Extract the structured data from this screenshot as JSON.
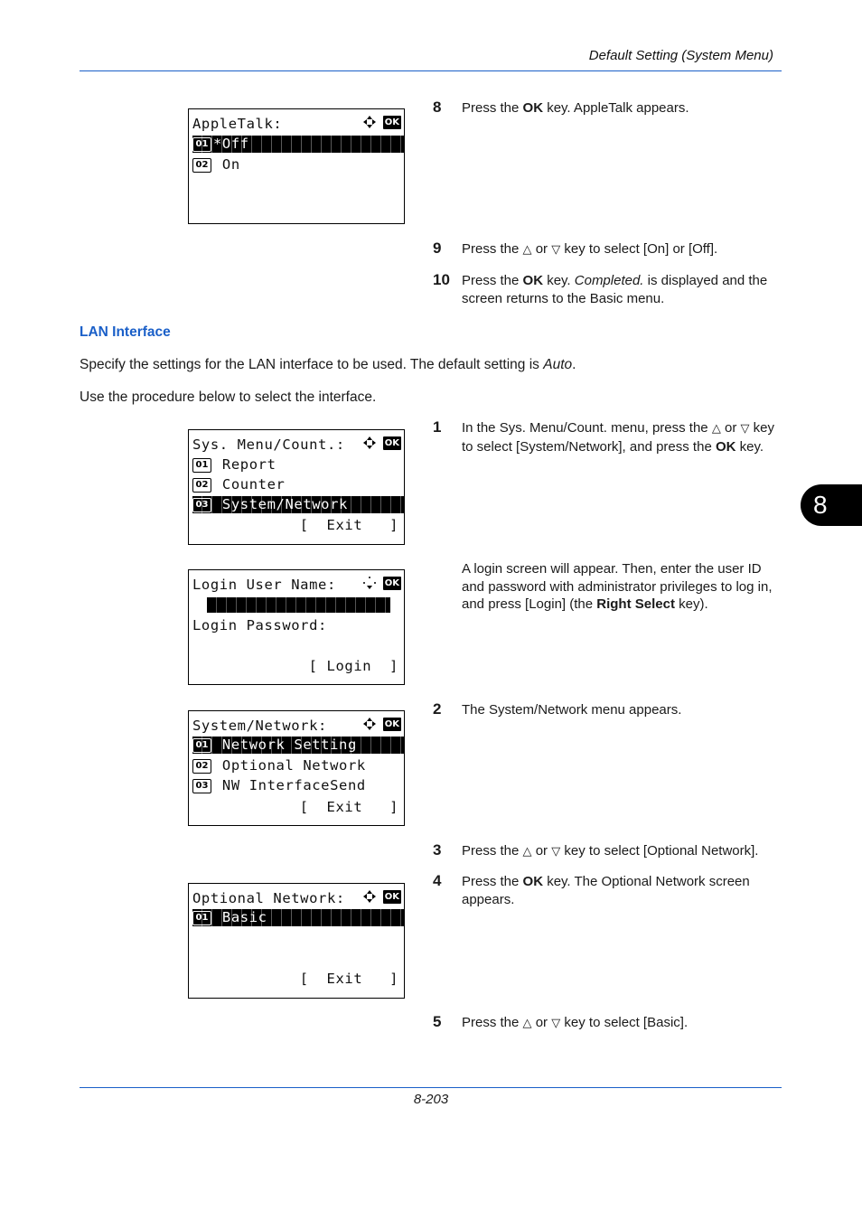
{
  "header": {
    "title": "Default Setting (System Menu)"
  },
  "footer": {
    "page_number": "8-203"
  },
  "chapter_tab": {
    "label": "8"
  },
  "colors": {
    "accent": "#1a5fc8",
    "text": "#1a1a1a",
    "lcd_highlight": "#000000"
  },
  "section": {
    "heading": "LAN Interface",
    "intro_parts": [
      "Specify the settings for the LAN interface to be used. The default setting is ",
      "Auto",
      "."
    ],
    "procedure": "Use the procedure below to select the interface."
  },
  "steps_top": [
    {
      "num": "8",
      "parts": [
        "Press the ",
        "OK",
        " key. AppleTalk appears."
      ]
    },
    {
      "num": "9",
      "parts": [
        "Press the ",
        "△",
        " or ",
        "▽",
        " key to select [On] or [Off]."
      ]
    },
    {
      "num": "10",
      "parts": [
        "Press the ",
        "OK",
        " key. ",
        "Completed.",
        " is displayed and the screen returns to the Basic menu."
      ]
    }
  ],
  "steps": [
    {
      "num": "1",
      "parts": [
        "In the Sys. Menu/Count. menu, press the ",
        "△",
        " or ",
        "▽",
        " key to select [System/Network], and press the ",
        "OK",
        " key."
      ]
    },
    {
      "num": "",
      "parts": [
        "A login screen will appear. Then, enter the user ID and password with administrator privileges to log in, and press [Login] (the ",
        "Right Select",
        " key)."
      ]
    },
    {
      "num": "2",
      "parts": [
        "The System/Network menu appears."
      ]
    },
    {
      "num": "3",
      "parts": [
        "Press the ",
        "△",
        " or ",
        "▽",
        " key to select [Optional Network]."
      ]
    },
    {
      "num": "4",
      "parts": [
        "Press the ",
        "OK",
        " key. The Optional Network screen appears."
      ]
    },
    {
      "num": "5",
      "parts": [
        "Press the ",
        "△",
        " or ",
        "▽",
        " key to select [Basic]."
      ]
    }
  ],
  "screens": {
    "appletalk": {
      "title": "AppleTalk:",
      "items": [
        {
          "num": "01",
          "label": "*Off",
          "selected": true
        },
        {
          "num": "02",
          "label": " On",
          "selected": false
        }
      ]
    },
    "sysmenu": {
      "title": "Sys. Menu/Count.:",
      "items": [
        {
          "num": "01",
          "label": " Report",
          "selected": false
        },
        {
          "num": "02",
          "label": " Counter",
          "selected": false
        },
        {
          "num": "03",
          "label": " System/Network",
          "selected": true
        }
      ],
      "softkey": "[  Exit   ]"
    },
    "login": {
      "user_label": "Login User Name:",
      "password_label": "Login Password:",
      "softkey": "[ Login  ]"
    },
    "sysnet": {
      "title": "System/Network:",
      "items": [
        {
          "num": "01",
          "label": " Network Setting",
          "selected": true
        },
        {
          "num": "02",
          "label": " Optional Network",
          "selected": false
        },
        {
          "num": "03",
          "label": " NW InterfaceSend",
          "selected": false
        }
      ],
      "softkey": "[  Exit   ]"
    },
    "optnet": {
      "title": "Optional Network:",
      "items": [
        {
          "num": "01",
          "label": " Basic",
          "selected": true
        }
      ],
      "softkey": "[  Exit   ]"
    },
    "icons": {
      "nav": "four-way-arrow-icon",
      "ok": "OK"
    }
  }
}
